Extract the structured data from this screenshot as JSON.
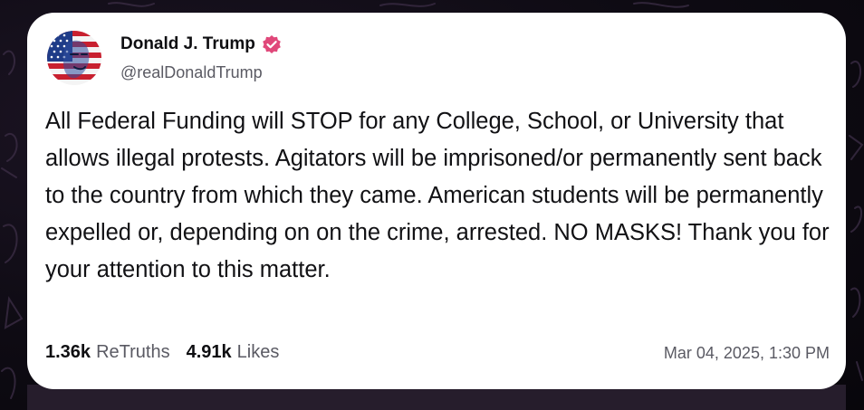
{
  "post": {
    "author_name": "Donald J. Trump",
    "handle": "@realDonaldTrump",
    "verified_icon": "verified-badge-icon",
    "body": "All Federal Funding will STOP for any College, School, or University that allows illegal protests. Agitators will be imprisoned/or permanently sent back to the country from which they came. American students will be permanently expelled or, depending on on the crime, arrested. NO MASKS! Thank you for your attention to this matter.",
    "stats": {
      "retruths_count": "1.36k",
      "retruths_label": "ReTruths",
      "likes_count": "4.91k",
      "likes_label": "Likes"
    },
    "timestamp": "Mar 04, 2025, 1:30 PM"
  },
  "colors": {
    "card_background": "#ffffff",
    "page_background": "#0d0a12",
    "verified_badge": "#e0487a",
    "primary_text": "#111114",
    "secondary_text": "#5a5a63"
  }
}
